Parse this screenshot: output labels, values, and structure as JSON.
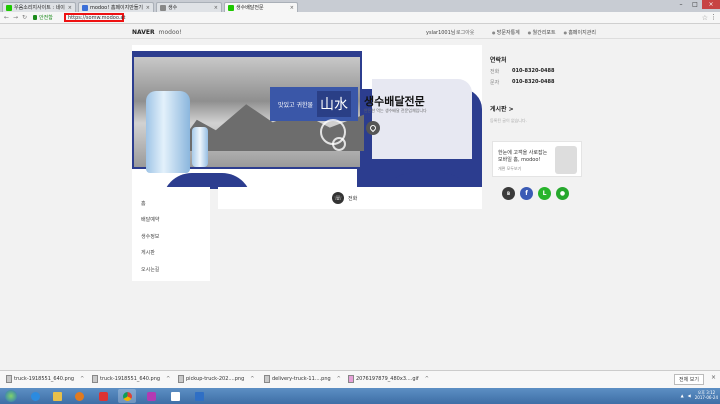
{
  "browser": {
    "tabs": [
      {
        "label": "우음소리지사이트 : 네이",
        "active": false
      },
      {
        "label": "modoo! 홈페이지만들기",
        "active": false
      },
      {
        "label": "생수",
        "active": false
      },
      {
        "label": "생수배달전문",
        "active": true
      }
    ],
    "secure_label": "안전함",
    "url": "https://somw.modoo.at"
  },
  "site": {
    "logo": "NAVER",
    "logo_sub": "modoo!",
    "user": "yslar1001님",
    "logout": "로그아웃",
    "links": [
      "방문자통계",
      "월간리포트",
      "홈페이지관리"
    ]
  },
  "hero": {
    "banner_text": "맛있고 귀한물",
    "banner_hanja": "山水",
    "title": "생수배달전문",
    "subtitle": "안전한 먹는 생수배달 전문업체입니다"
  },
  "sidebar": {
    "contact_title": "연락처",
    "rows": [
      {
        "k": "전화",
        "v": "010-8320-0488"
      },
      {
        "k": "문자",
        "v": "010-8320-0488"
      }
    ],
    "board_title": "게시판",
    "board_chevron": ">",
    "board_empty": "등록된 글이 없습니다.",
    "promo_text": "모바일 홈, modoo!",
    "promo_line1": "한눈에 고객을 사로잡는",
    "promo_line2": "개편 모두보기"
  },
  "menu": {
    "items": [
      "홈",
      "배달예약",
      "생수정보",
      "게시판",
      "오시는길"
    ]
  },
  "call": {
    "label": "전화"
  },
  "downloads": {
    "items": [
      "truck-1918551_640.png",
      "truck-1918551_640.png",
      "pickup-truck-202....png",
      "delivery-truck-11....png",
      "2076197879_480x3....gif"
    ],
    "show_all": "전체 보기"
  },
  "taskbar": {
    "time": "오후 3:12",
    "date": "2017-06-24"
  },
  "colors": {
    "accent": "#2c3d8f",
    "naver_green": "#1ec800",
    "url_highlight": "#ee1111"
  }
}
